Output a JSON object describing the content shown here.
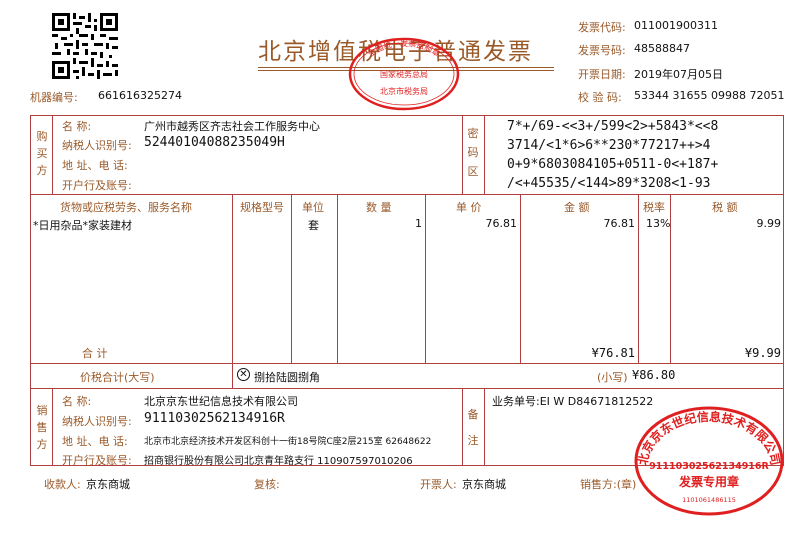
{
  "header": {
    "title": "北京增值税电子普通发票",
    "machine_label": "机器编号:",
    "machine_no": "661616325274",
    "code_label": "发票代码:",
    "code": "011001900311",
    "number_label": "发票号码:",
    "number": "48588847",
    "date_label": "开票日期:",
    "date": "2019年07月05日",
    "check_label": "校 验 码:",
    "check_code": "53344 31655 09988 72051"
  },
  "seal_top": {
    "outer_text": "全国统一发票监制章",
    "middle_text": "国家税务总局",
    "bottom_text": "北京市税务局"
  },
  "buyer": {
    "section_label": "购买方",
    "name_label": "名        称:",
    "name": "广州市越秀区齐志社会工作服务中心",
    "tax_label": "纳税人识别号:",
    "tax_id": "52440104088235049H",
    "addr_label": "地 址、电 话:",
    "bank_label": "开户行及账号:"
  },
  "cipher": {
    "section_label": "密码区",
    "lines": [
      "7*+/69-<<3+/599<2>+5843*<<8",
      "3714/<1*6>6**230*77217++>4",
      "0+9*6803084105+0511-0<+187+",
      "/<+45535/<144>89*3208<1-93"
    ]
  },
  "columns": {
    "item": "货物或应税劳务、服务名称",
    "spec": "规格型号",
    "unit": "单位",
    "qty": "数 量",
    "price": "单 价",
    "amount": "金 额",
    "rate": "税率",
    "tax": "税 额"
  },
  "items": [
    {
      "name": "*日用杂品*家装建材",
      "spec": "",
      "unit": "套",
      "qty": "1",
      "price": "76.81",
      "amount": "76.81",
      "rate": "13%",
      "tax": "9.99"
    }
  ],
  "totals": {
    "label": "合        计",
    "amount": "¥76.81",
    "tax": "¥9.99",
    "total_label": "价税合计(大写)",
    "total_upper": "捌拾陆圆捌角",
    "small_label": "(小写)",
    "total_small": "¥86.80"
  },
  "seller": {
    "section_label": "销售方",
    "name_label": "名        称:",
    "name": "北京京东世纪信息技术有限公司",
    "tax_label": "纳税人识别号:",
    "tax_id": "91110302562134916R",
    "addr_label": "地 址、电 话:",
    "addr": "北京市北京经济技术开发区科创十一街18号院C座2层215室 62648622",
    "bank_label": "开户行及账号:",
    "bank": "招商银行股份有限公司北京青年路支行 110907597010206"
  },
  "remarks": {
    "section_label": "备注",
    "text": "业务单号:EI W D84671812522"
  },
  "seal_seller": {
    "outer_text": "北京京东世纪信息技术有限公司",
    "tax_id": "91110302562134916R",
    "label": "发票专用章",
    "bottom_no": "1101061486115"
  },
  "footer": {
    "payee_label": "收款人:",
    "payee": "京东商城",
    "reviewer_label": "复核:",
    "issuer_label": "开票人:",
    "issuer": "京东商城",
    "seller_label": "销售方:(章)"
  },
  "colors": {
    "label": "#9a5a2a",
    "border": "#b04040",
    "seal": "#e02020"
  }
}
